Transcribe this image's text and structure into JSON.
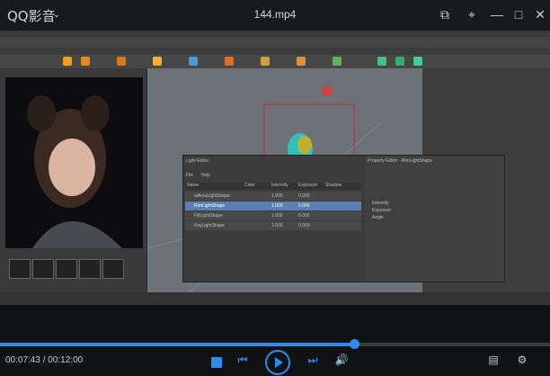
{
  "player": {
    "app_name": "QQ影音",
    "file_name": "144.mp4",
    "position": "00:07:43",
    "separator": "/",
    "duration": "00:12:00",
    "progress_fraction": 0.643,
    "accent": "#2d8cf0",
    "icons": [
      "chevron-down-icon",
      "screenshot-icon",
      "pin-icon",
      "minimize-icon",
      "maximize-icon",
      "close-icon"
    ]
  },
  "maya": {
    "light_editor": {
      "title": "Light Editor",
      "menu": [
        "File",
        "Help"
      ],
      "columns": [
        "Name",
        "Color",
        "Intensity",
        "Exposure",
        "Shadow"
      ],
      "rows": [
        {
          "name": "aiAreaLightShape",
          "intensity": "1.000",
          "exposure": "0.000"
        },
        {
          "name": "RimLightShape",
          "intensity": "1.000",
          "exposure": "0.000"
        },
        {
          "name": "FillLightShape",
          "intensity": "1.000",
          "exposure": "0.000"
        },
        {
          "name": "KeyLightShape",
          "intensity": "1.000",
          "exposure": "0.000"
        }
      ]
    },
    "property_editor": {
      "title": "Property Editor - RimLightShape",
      "fields": [
        "Intensity",
        "Exposure",
        "Angle"
      ]
    }
  }
}
